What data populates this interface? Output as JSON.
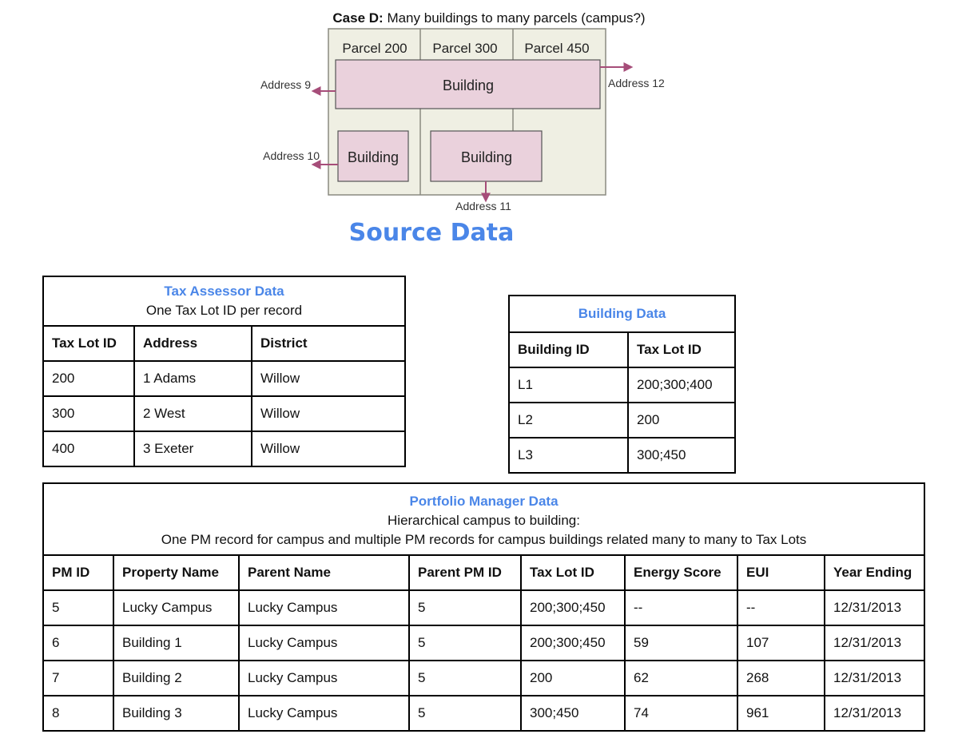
{
  "diagram": {
    "title_bold": "Case D:",
    "title_rest": " Many buildings to many parcels (campus?)",
    "parcels": [
      "Parcel 200",
      "Parcel 300",
      "Parcel 450"
    ],
    "buildings": [
      "Building",
      "Building",
      "Building"
    ],
    "addresses": [
      "Address 9",
      "Address 12",
      "Address 10",
      "Address 11"
    ],
    "colors": {
      "building_fill": "#ead1dc",
      "parcel_fill": "#efefe3",
      "arrow": "#a64d79"
    }
  },
  "section_title": "Source Data",
  "tax_assessor": {
    "title": "Tax Assessor Data",
    "subtitle": "One Tax Lot ID per record",
    "headers": [
      "Tax Lot ID",
      "Address",
      "District"
    ],
    "rows": [
      [
        "200",
        "1 Adams",
        "Willow"
      ],
      [
        "300",
        "2 West",
        "Willow"
      ],
      [
        "400",
        "3 Exeter",
        "Willow"
      ]
    ]
  },
  "building_data": {
    "title": "Building Data",
    "headers": [
      "Building ID",
      "Tax Lot ID"
    ],
    "rows": [
      [
        "L1",
        "200;300;400"
      ],
      [
        "L2",
        "200"
      ],
      [
        "L3",
        "300;450"
      ]
    ]
  },
  "portfolio_manager": {
    "title": "Portfolio Manager Data",
    "subtitle1": "Hierarchical campus to building:",
    "subtitle2": "One PM record for campus and multiple PM records for campus buildings related many to many to Tax Lots",
    "headers": [
      "PM ID",
      "Property Name",
      "Parent Name",
      "Parent PM ID",
      "Tax Lot ID",
      "Energy Score",
      "EUI",
      "Year Ending"
    ],
    "rows": [
      [
        "5",
        "Lucky Campus",
        "Lucky Campus",
        "5",
        "200;300;450",
        "--",
        "--",
        "12/31/2013"
      ],
      [
        "6",
        "Building 1",
        "Lucky Campus",
        "5",
        "200;300;450",
        "59",
        "107",
        "12/31/2013"
      ],
      [
        "7",
        "Building 2",
        "Lucky Campus",
        "5",
        "200",
        "62",
        "268",
        "12/31/2013"
      ],
      [
        "8",
        "Building 3",
        "Lucky Campus",
        "5",
        "300;450",
        "74",
        "961",
        "12/31/2013"
      ]
    ]
  }
}
